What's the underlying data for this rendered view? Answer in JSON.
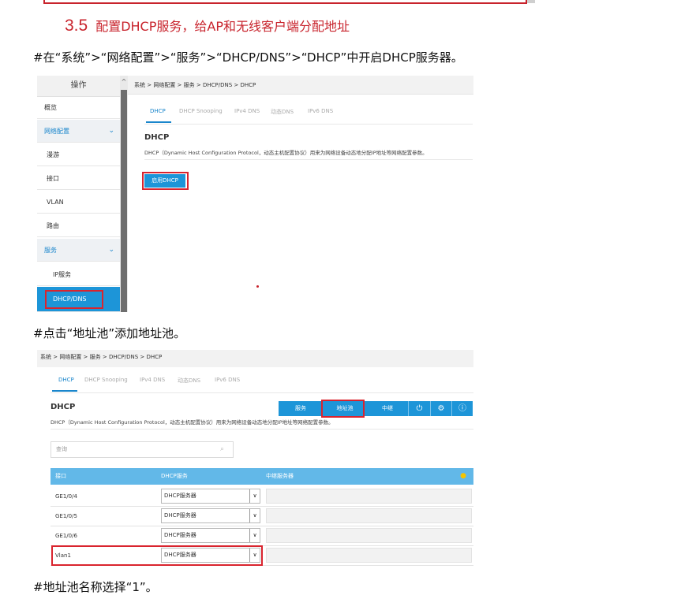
{
  "section": {
    "number": "3.5",
    "title": "配置DHCP服务，给AP和无线客户端分配地址"
  },
  "instructions": [
    "#在“系统”>“网络配置”>“服务”>“DHCP/DNS”>“DHCP”中开启DHCP服务器。",
    "#点击“地址池”添加地址池。",
    "#地址池名称选择“1”。"
  ],
  "shot1": {
    "sidebar_title": "操作",
    "sidebar_items": [
      "概览",
      "网络配置",
      "漫游",
      "接口",
      "VLAN",
      "路由",
      "服务",
      "IP服务",
      "DHCP/DNS"
    ],
    "breadcrumb": "系统 > 网络配置 > 服务 > DHCP/DNS > DHCP",
    "tabs": [
      "DHCP",
      "DHCP Snooping",
      "IPv4 DNS",
      "动态DNS",
      "IPv6 DNS"
    ],
    "heading": "DHCP",
    "description": "DHCP（Dynamic Host Configuration Protocol，动态主机配置协议）用来为网络设备动态地分配IP地址等网络配置参数。",
    "enable_button": "启用DHCP"
  },
  "shot2": {
    "breadcrumb": "系统 > 网络配置 > 服务 > DHCP/DNS > DHCP",
    "tabs": [
      "DHCP",
      "DHCP Snooping",
      "IPv4 DNS",
      "动态DNS",
      "IPv6 DNS"
    ],
    "heading": "DHCP",
    "description": "DHCP（Dynamic Host Configuration Protocol，动态主机配置协议）用来为网络设备动态地分配IP地址等网络配置参数。",
    "toolbar": [
      "服务",
      "地址池",
      "中继"
    ],
    "search_placeholder": "查询",
    "columns": [
      "接口",
      "DHCP服务",
      "中继服务器"
    ],
    "rows": [
      {
        "interface": "GE1/0/4",
        "service": "DHCP服务器"
      },
      {
        "interface": "GE1/0/5",
        "service": "DHCP服务器"
      },
      {
        "interface": "GE1/0/6",
        "service": "DHCP服务器"
      },
      {
        "interface": "Vlan1",
        "service": "DHCP服务器"
      }
    ]
  },
  "colors": {
    "accent": "#1d95d8",
    "highlight": "#d9242e",
    "heading": "#c8232c"
  }
}
